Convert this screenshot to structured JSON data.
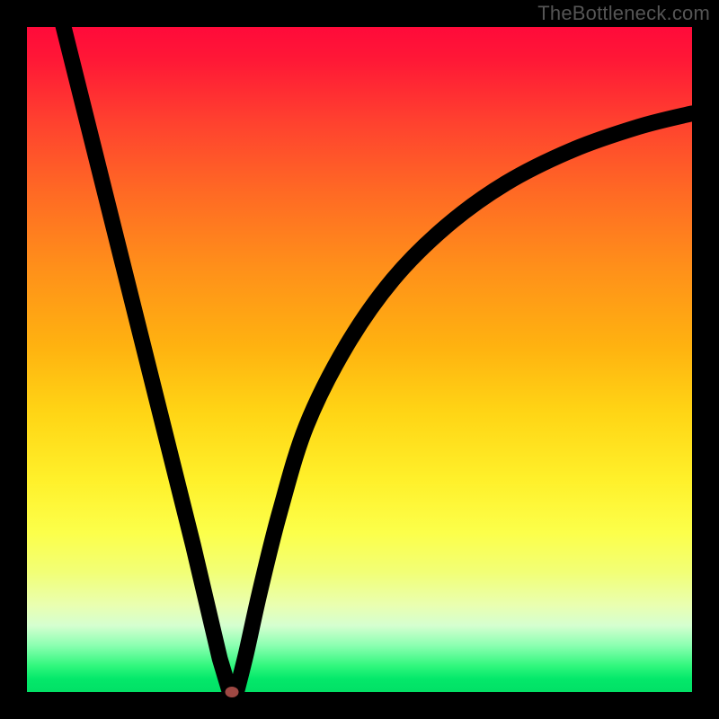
{
  "watermark": "TheBottleneck.com",
  "chart_data": {
    "type": "line",
    "title": "",
    "xlabel": "",
    "ylabel": "",
    "xlim": [
      0,
      100
    ],
    "ylim": [
      0,
      100
    ],
    "grid": false,
    "legend": false,
    "series": [
      {
        "name": "left-segment",
        "x": [
          5,
          10,
          15,
          20,
          25,
          29,
          30.5
        ],
        "y": [
          102,
          82,
          62,
          42,
          22,
          5,
          0
        ]
      },
      {
        "name": "right-segment",
        "x": [
          31.5,
          33,
          35,
          38,
          42,
          48,
          55,
          63,
          72,
          82,
          92,
          100
        ],
        "y": [
          0,
          6,
          15,
          27,
          40,
          52,
          62,
          70,
          76.5,
          81.5,
          85,
          87
        ]
      }
    ],
    "marker": {
      "x": 30.8,
      "y": 0
    },
    "colors": {
      "curve": "#000000",
      "marker": "#c65a54"
    }
  }
}
